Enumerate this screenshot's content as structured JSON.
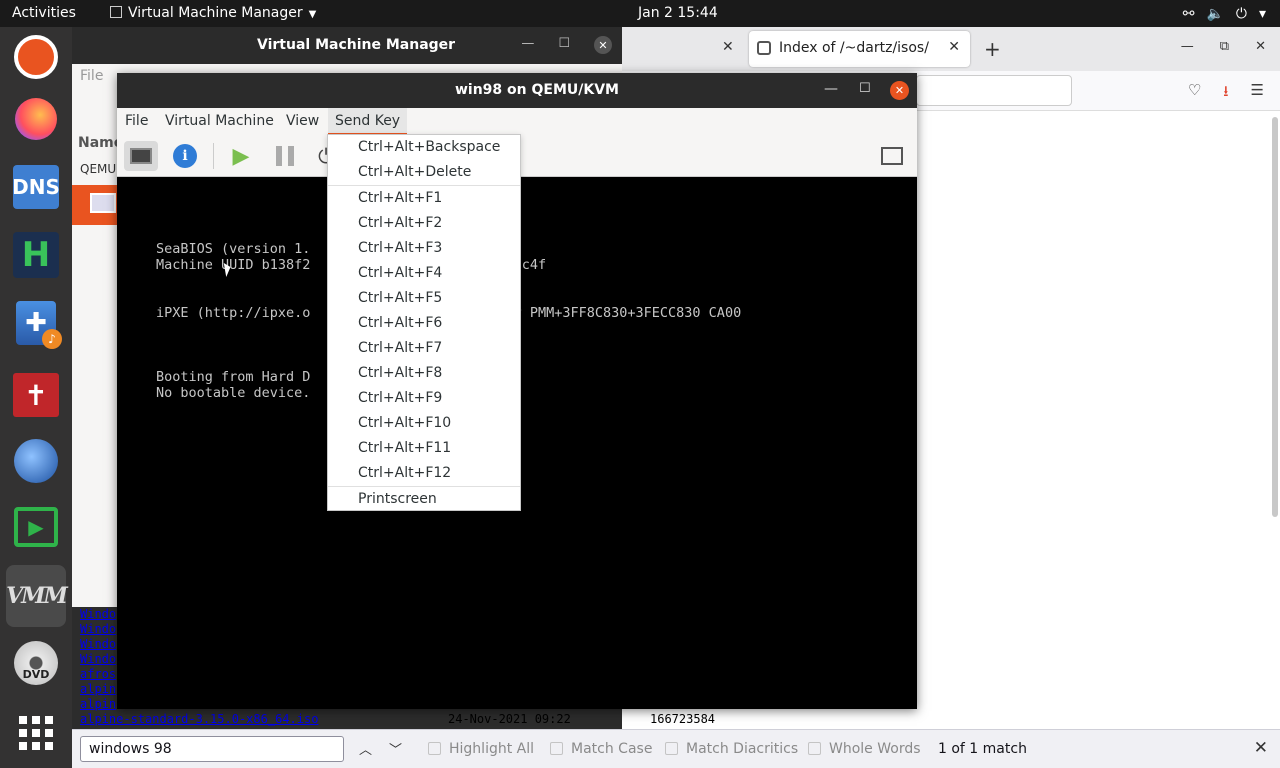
{
  "topbar": {
    "activities": "Activities",
    "app_name": "Virtual Machine Manager",
    "clock": "Jan 2  15:44"
  },
  "dock": {
    "items": [
      "ubuntu",
      "firefox",
      "DNS",
      "H",
      "bible",
      "cross",
      "satellite",
      "recorder",
      "VMM",
      "DVD",
      "app-grid"
    ],
    "dns_label": "DNS",
    "h_label": "H",
    "vmm_label": "VMM",
    "dvd_label": "DVD"
  },
  "vmm_main": {
    "title": "Virtual Machine Manager",
    "menu_file": "File",
    "col_name": "Name",
    "group": "QEMU"
  },
  "console": {
    "title": "win98 on QEMU/KVM",
    "menus": {
      "file": "File",
      "virtual_machine": "Virtual Machine",
      "view": "View",
      "send_key": "Send Key"
    },
    "screen_lines": {
      "seabios": "SeaBIOS (version 1.",
      "uuid": "Machine UUID b138f2                    38e66ec4f",
      "ipxe": "iPXE (http://ipxe.o                    10 PnP PMM+3FF8C830+3FECC830 CA00",
      "boot": "Booting from Hard D",
      "nodev": "No bootable device."
    }
  },
  "sendkey_menu": {
    "items": [
      "Ctrl+Alt+Backspace",
      "Ctrl+Alt+Delete",
      "Ctrl+Alt+F1",
      "Ctrl+Alt+F2",
      "Ctrl+Alt+F3",
      "Ctrl+Alt+F4",
      "Ctrl+Alt+F5",
      "Ctrl+Alt+F6",
      "Ctrl+Alt+F7",
      "Ctrl+Alt+F8",
      "Ctrl+Alt+F9",
      "Ctrl+Alt+F10",
      "Ctrl+Alt+F11",
      "Ctrl+Alt+F12",
      "Printscreen"
    ]
  },
  "firefox": {
    "tab_title": "Index of /~dartz/isos/",
    "listing": [
      {
        "name": "Windo",
        "date": "",
        "size": ""
      },
      {
        "name": "Windo",
        "date": "",
        "size": ""
      },
      {
        "name": "Windo",
        "date": "",
        "size": ""
      },
      {
        "name": "Windo",
        "date": "",
        "size": ""
      },
      {
        "name": "afros",
        "date": "",
        "size": ""
      },
      {
        "name": "alpin",
        "date": "",
        "size": ""
      },
      {
        "name": "alpin",
        "date": "",
        "size": ""
      },
      {
        "name": "alpine-standard-3.15.0-x86_64.iso",
        "date": "24-Nov-2021 09:22",
        "size": "166723584"
      }
    ],
    "findbar": {
      "query": "windows 98",
      "highlight_all": "Highlight All",
      "match_case": "Match Case",
      "match_diacritics": "Match Diacritics",
      "whole_words": "Whole Words",
      "status": "1 of 1 match"
    }
  },
  "colors": {
    "accent": "#e95420",
    "titlebar": "#2b2b2b",
    "link": "#0000ee"
  }
}
